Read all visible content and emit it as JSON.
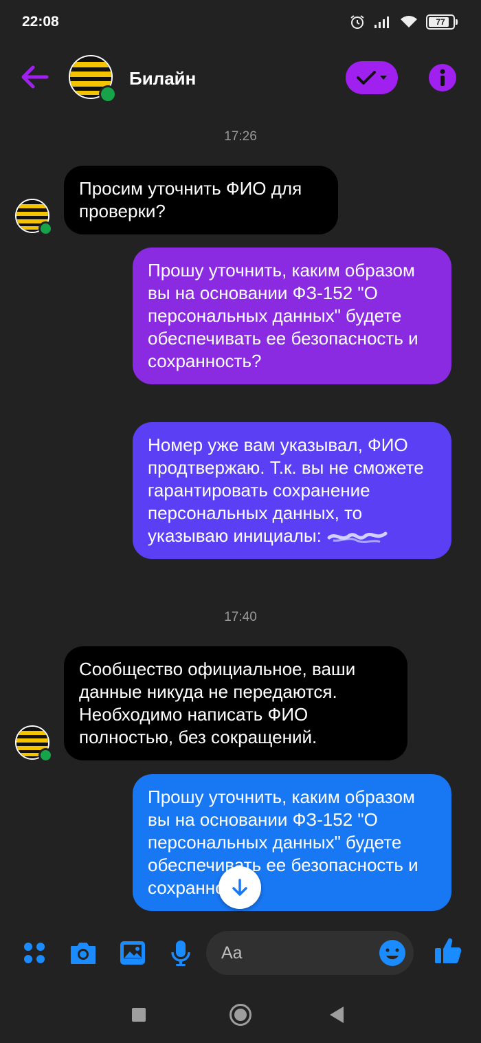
{
  "status_bar": {
    "time": "22:08",
    "battery": "77",
    "icons": [
      "alarm-icon",
      "signal-icon",
      "wifi-icon",
      "battery-icon"
    ]
  },
  "header": {
    "title": "Билайн",
    "back_icon": "arrow-left-icon",
    "status_icon": "check-dropdown-icon",
    "info_icon": "info-icon",
    "accent_color": "#a020f0",
    "online_color": "#16a34a"
  },
  "messages": [
    {
      "type": "timestamp",
      "text": "17:26"
    },
    {
      "type": "incoming",
      "text": "Просим уточнить ФИО для проверки?"
    },
    {
      "type": "outgoing",
      "text": "Прошу уточнить, каким образом вы на основании ФЗ-152 \"О персональных данных\" будете обеспечивать ее безопасность и сохранность?"
    },
    {
      "type": "outgoing",
      "text": "Номер уже вам указывал, ФИО продтвержаю. Т.к. вы не сможете гарантировать сохранение персональных данных, то указываю инициалы:"
    },
    {
      "type": "timestamp",
      "text": "17:40"
    },
    {
      "type": "incoming",
      "text": "Сообщество официальное, ваши данные никуда не передаются. Необходимо написать ФИО полностью, без сокращений."
    },
    {
      "type": "outgoing",
      "text": "Прошу уточнить, каким образом вы на основании ФЗ-152 \"О персональных данных\" будете обеспечивать ее безопасность и сохранность?"
    }
  ],
  "composer": {
    "placeholder": "Aa",
    "icons": [
      "apps-icon",
      "camera-icon",
      "gallery-icon",
      "microphone-icon",
      "emoji-icon",
      "thumbs-up-icon"
    ],
    "icon_color": "#1a8cff"
  },
  "bubble_colors": {
    "incoming": "#000000",
    "outgoing_1": "#8a2be2",
    "outgoing_2": "#5b3ff5",
    "outgoing_3": "#1877f2"
  }
}
